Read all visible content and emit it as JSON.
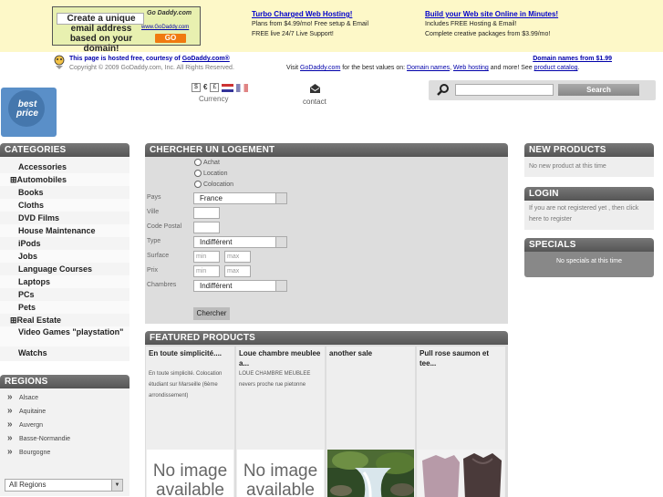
{
  "banner": {
    "ad_text": "Create a unique email address based on your domain!",
    "ad_logo": "Go Daddy.com",
    "ad_url": "www.GoDaddy.com",
    "ad_go": "GO",
    "col1": {
      "title": "Turbo Charged Web Hosting!",
      "line1": "Plans from $4.99/mo! Free setup & Email",
      "line2": "FREE live 24/7 Live Support!"
    },
    "col2": {
      "title": "Build your Web site Online in Minutes!",
      "line1": "Includes FREE Hosting & Email!",
      "line2": "Complete creative packages from $3.99/mo!"
    }
  },
  "hosted": {
    "line1_prefix": "This page is hosted free, courtesy of ",
    "line1_link": "GoDaddy.com®",
    "line2": "Copyright © 2009 GoDaddy.com, Inc. All Rights Reserved.",
    "right_link": "Domain names from $1.99",
    "visit_prefix": "Visit ",
    "visit_link": "GoDaddy.com",
    "visit_mid": " for the best values on: ",
    "link_domains": "Domain names",
    "sep": ", ",
    "link_hosting": "Web hosting",
    "visit_tail": " and more! See ",
    "link_catalog": "product catalog",
    "period": "."
  },
  "header": {
    "logo_text": "best price",
    "currency_buttons": [
      "$",
      "€",
      "£"
    ],
    "currency_label": "Currency",
    "contact_label": "contact",
    "search_placeholder": "",
    "search_button": "Search"
  },
  "categories": {
    "title": "CATEGORIES",
    "items": [
      "Accessories",
      "⊞Automobiles",
      "Books",
      "Cloths",
      "DVD Films",
      "House Maintenance",
      "iPods",
      "Jobs",
      "Language Courses",
      "Laptops",
      "PCs",
      "Pets",
      "⊞Real Estate",
      "Video Games \"playstation\"",
      "Watchs"
    ]
  },
  "regions": {
    "title": "REGIONS",
    "items": [
      "Alsace",
      "Aquitaine",
      "Auvergn",
      "Basse-Normandie",
      "Bourgogne"
    ],
    "select_value": "All Regions"
  },
  "search_form": {
    "title": "CHERCHER UN LOGEMENT",
    "radios": [
      "Achat",
      "Location",
      "Colocation"
    ],
    "labels": {
      "pays": "Pays",
      "ville": "Ville",
      "cp": "Code Postal",
      "type": "Type",
      "surface": "Surface",
      "prix": "Prix",
      "chambres": "Chambres"
    },
    "pays_value": "France",
    "type_value": "Indifférent",
    "chambres_value": "Indifférent",
    "min_placeholder": "min",
    "max_placeholder": "max",
    "submit": "Chercher"
  },
  "featured": {
    "title": "FEATURED PRODUCTS",
    "products": [
      {
        "title": "En toute simplicité....",
        "desc": "En toute simplicité. Colocation étudiant sur Marseille (6ème arrondissement)",
        "image": "No image available"
      },
      {
        "title": "Loue chambre meublee a...",
        "desc": "LOUE CHAMBRE MEUBLEE nevers proche rue pietonne",
        "image": "No image available"
      },
      {
        "title": "another sale",
        "desc": "",
        "image": "waterfall-photo"
      },
      {
        "title": "Pull rose saumon et tee...",
        "desc": "",
        "image": "sweaters-photo"
      }
    ]
  },
  "right": {
    "new_products_title": "NEW PRODUCTS",
    "new_products_text": "No new product at this time",
    "login_title": "LOGIN",
    "login_text": "If you are not registered yet , then click here to register",
    "specials_title": "SPECIALS",
    "specials_text": "No specials at this time"
  }
}
